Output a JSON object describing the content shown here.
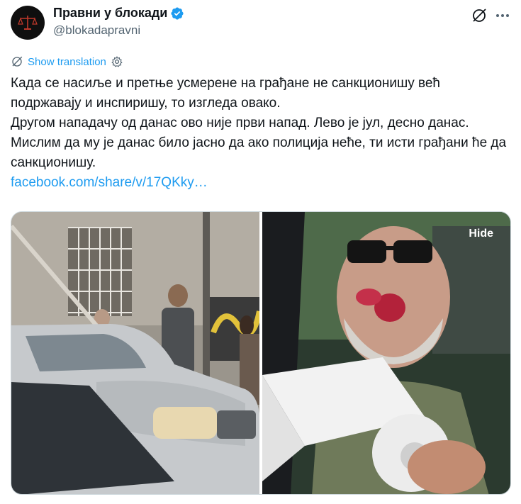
{
  "account": {
    "display_name": "Правни у блокади",
    "handle": "@blokadapravni",
    "avatar_icon": "scales-of-justice-icon",
    "verified_color": "#1d9bf0"
  },
  "actions": {
    "grok_icon": "grok-icon",
    "more_icon": "more-dots-icon"
  },
  "translation": {
    "label": "Show translation",
    "settings_icon": "gear-icon"
  },
  "tweet": {
    "paragraphs": [
      "Када се насиље и претње усмерене на грађане не санкционишу већ подржавају и инспиришу, то изгледа овако.",
      "Другом нападачу од данас ово није први напад. Лево је јул, десно данас. Мислим да му је данас било јасно да ако полиција неће, ти исти грађани ће да санкционишу."
    ],
    "link": "facebook.com/share/v/17QKky…"
  },
  "media": {
    "hide_label": "Hide",
    "left_photo": "street-scene-with-car-photo",
    "right_photo": "man-with-bloody-face-photo"
  },
  "colors": {
    "accent": "#1d9bf0",
    "text": "#0f1419",
    "secondary": "#536471"
  }
}
